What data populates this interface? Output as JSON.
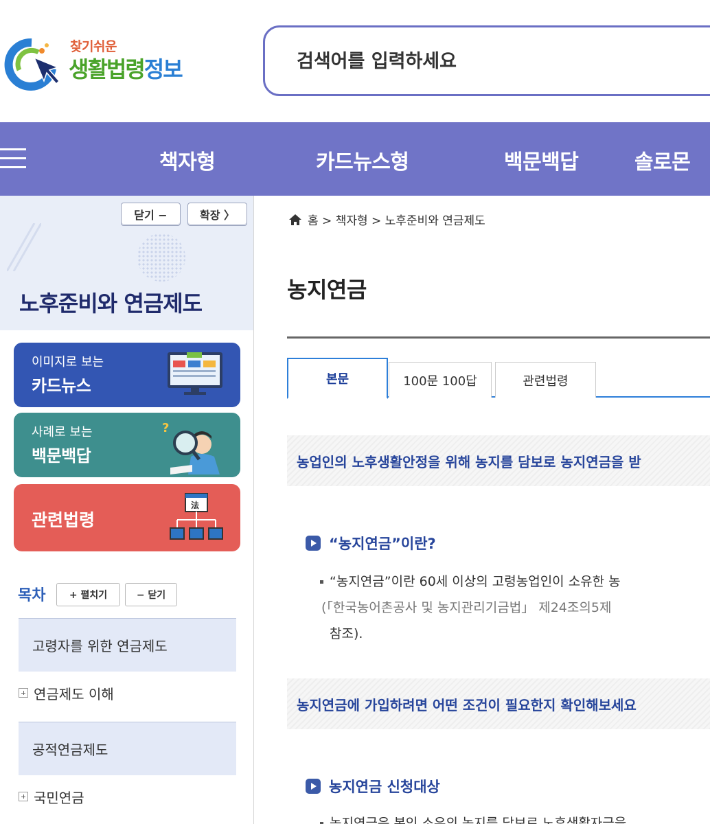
{
  "header": {
    "logo_small": "찾기쉬운",
    "logo_big_main": "생활법령",
    "logo_big_accent": "정보",
    "search_placeholder": "검색어를 입력하세요"
  },
  "nav": {
    "items": [
      "책자형",
      "카드뉴스형",
      "백문백답",
      "솔로몬"
    ]
  },
  "sidebar": {
    "close_label": "닫기 −",
    "expand_label": "확장 〉",
    "title": "노후준비와 연금제도",
    "cards": [
      {
        "sub": "이미지로 보는",
        "main": "카드뉴스",
        "color": "#3356b3",
        "icon": "news-monitor-icon"
      },
      {
        "sub": "사례로 보는",
        "main": "백문백답",
        "color": "#3e8f8e",
        "icon": "magnifier-person-icon"
      },
      {
        "sub": "",
        "main": "관련법령",
        "color": "#e45d57",
        "icon": "law-hierarchy-icon"
      }
    ],
    "toc_title": "목차",
    "toc_expand": "+ 펼치기",
    "toc_collapse": "− 닫기",
    "toc": [
      {
        "type": "section",
        "label": "고령자를 위한 연금제도"
      },
      {
        "type": "item",
        "label": "연금제도 이해"
      },
      {
        "type": "section",
        "label": "공적연금제도"
      },
      {
        "type": "item",
        "label": "국민연금"
      }
    ]
  },
  "main": {
    "breadcrumb": "홈 > 책자형 > 노후준비와 연금제도",
    "title": "농지연금",
    "tabs": [
      "본문",
      "100문 100답",
      "관련법령"
    ],
    "banner1": "농업인의 노후생활안정을 위해 농지를 담보로 농지연금을 받",
    "heading1": "“농지연금”이란?",
    "para1_line1": "“농지연금”이란 60세 이상의 고령농업인이 소유한 농",
    "para1_line2_ref": "(「한국농어촌공사 및 농지관리기금법」 제24조의5제",
    "para1_line3": "참조).",
    "banner2": "농지연금에 가입하려면 어떤 조건이 필요한지 확인해보세요",
    "heading2": "농지연금 신청대상",
    "para2_line1": "농지연금은 본인 소유의 농지를 담보로 노후생활자금을"
  }
}
